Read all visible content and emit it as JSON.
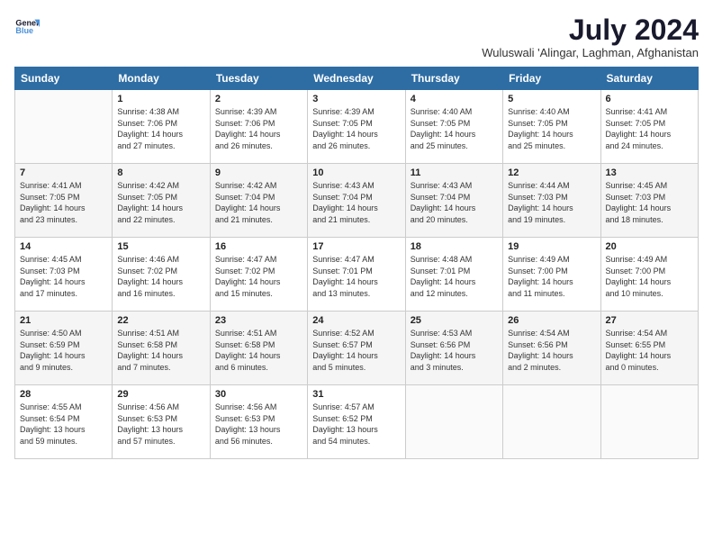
{
  "logo": {
    "line1": "General",
    "line2": "Blue"
  },
  "title": "July 2024",
  "location": "Wuluswali 'Alingar, Laghman, Afghanistan",
  "weekdays": [
    "Sunday",
    "Monday",
    "Tuesday",
    "Wednesday",
    "Thursday",
    "Friday",
    "Saturday"
  ],
  "weeks": [
    [
      {
        "day": "",
        "info": ""
      },
      {
        "day": "1",
        "info": "Sunrise: 4:38 AM\nSunset: 7:06 PM\nDaylight: 14 hours\nand 27 minutes."
      },
      {
        "day": "2",
        "info": "Sunrise: 4:39 AM\nSunset: 7:06 PM\nDaylight: 14 hours\nand 26 minutes."
      },
      {
        "day": "3",
        "info": "Sunrise: 4:39 AM\nSunset: 7:05 PM\nDaylight: 14 hours\nand 26 minutes."
      },
      {
        "day": "4",
        "info": "Sunrise: 4:40 AM\nSunset: 7:05 PM\nDaylight: 14 hours\nand 25 minutes."
      },
      {
        "day": "5",
        "info": "Sunrise: 4:40 AM\nSunset: 7:05 PM\nDaylight: 14 hours\nand 25 minutes."
      },
      {
        "day": "6",
        "info": "Sunrise: 4:41 AM\nSunset: 7:05 PM\nDaylight: 14 hours\nand 24 minutes."
      }
    ],
    [
      {
        "day": "7",
        "info": "Sunrise: 4:41 AM\nSunset: 7:05 PM\nDaylight: 14 hours\nand 23 minutes."
      },
      {
        "day": "8",
        "info": "Sunrise: 4:42 AM\nSunset: 7:05 PM\nDaylight: 14 hours\nand 22 minutes."
      },
      {
        "day": "9",
        "info": "Sunrise: 4:42 AM\nSunset: 7:04 PM\nDaylight: 14 hours\nand 21 minutes."
      },
      {
        "day": "10",
        "info": "Sunrise: 4:43 AM\nSunset: 7:04 PM\nDaylight: 14 hours\nand 21 minutes."
      },
      {
        "day": "11",
        "info": "Sunrise: 4:43 AM\nSunset: 7:04 PM\nDaylight: 14 hours\nand 20 minutes."
      },
      {
        "day": "12",
        "info": "Sunrise: 4:44 AM\nSunset: 7:03 PM\nDaylight: 14 hours\nand 19 minutes."
      },
      {
        "day": "13",
        "info": "Sunrise: 4:45 AM\nSunset: 7:03 PM\nDaylight: 14 hours\nand 18 minutes."
      }
    ],
    [
      {
        "day": "14",
        "info": "Sunrise: 4:45 AM\nSunset: 7:03 PM\nDaylight: 14 hours\nand 17 minutes."
      },
      {
        "day": "15",
        "info": "Sunrise: 4:46 AM\nSunset: 7:02 PM\nDaylight: 14 hours\nand 16 minutes."
      },
      {
        "day": "16",
        "info": "Sunrise: 4:47 AM\nSunset: 7:02 PM\nDaylight: 14 hours\nand 15 minutes."
      },
      {
        "day": "17",
        "info": "Sunrise: 4:47 AM\nSunset: 7:01 PM\nDaylight: 14 hours\nand 13 minutes."
      },
      {
        "day": "18",
        "info": "Sunrise: 4:48 AM\nSunset: 7:01 PM\nDaylight: 14 hours\nand 12 minutes."
      },
      {
        "day": "19",
        "info": "Sunrise: 4:49 AM\nSunset: 7:00 PM\nDaylight: 14 hours\nand 11 minutes."
      },
      {
        "day": "20",
        "info": "Sunrise: 4:49 AM\nSunset: 7:00 PM\nDaylight: 14 hours\nand 10 minutes."
      }
    ],
    [
      {
        "day": "21",
        "info": "Sunrise: 4:50 AM\nSunset: 6:59 PM\nDaylight: 14 hours\nand 9 minutes."
      },
      {
        "day": "22",
        "info": "Sunrise: 4:51 AM\nSunset: 6:58 PM\nDaylight: 14 hours\nand 7 minutes."
      },
      {
        "day": "23",
        "info": "Sunrise: 4:51 AM\nSunset: 6:58 PM\nDaylight: 14 hours\nand 6 minutes."
      },
      {
        "day": "24",
        "info": "Sunrise: 4:52 AM\nSunset: 6:57 PM\nDaylight: 14 hours\nand 5 minutes."
      },
      {
        "day": "25",
        "info": "Sunrise: 4:53 AM\nSunset: 6:56 PM\nDaylight: 14 hours\nand 3 minutes."
      },
      {
        "day": "26",
        "info": "Sunrise: 4:54 AM\nSunset: 6:56 PM\nDaylight: 14 hours\nand 2 minutes."
      },
      {
        "day": "27",
        "info": "Sunrise: 4:54 AM\nSunset: 6:55 PM\nDaylight: 14 hours\nand 0 minutes."
      }
    ],
    [
      {
        "day": "28",
        "info": "Sunrise: 4:55 AM\nSunset: 6:54 PM\nDaylight: 13 hours\nand 59 minutes."
      },
      {
        "day": "29",
        "info": "Sunrise: 4:56 AM\nSunset: 6:53 PM\nDaylight: 13 hours\nand 57 minutes."
      },
      {
        "day": "30",
        "info": "Sunrise: 4:56 AM\nSunset: 6:53 PM\nDaylight: 13 hours\nand 56 minutes."
      },
      {
        "day": "31",
        "info": "Sunrise: 4:57 AM\nSunset: 6:52 PM\nDaylight: 13 hours\nand 54 minutes."
      },
      {
        "day": "",
        "info": ""
      },
      {
        "day": "",
        "info": ""
      },
      {
        "day": "",
        "info": ""
      }
    ]
  ]
}
